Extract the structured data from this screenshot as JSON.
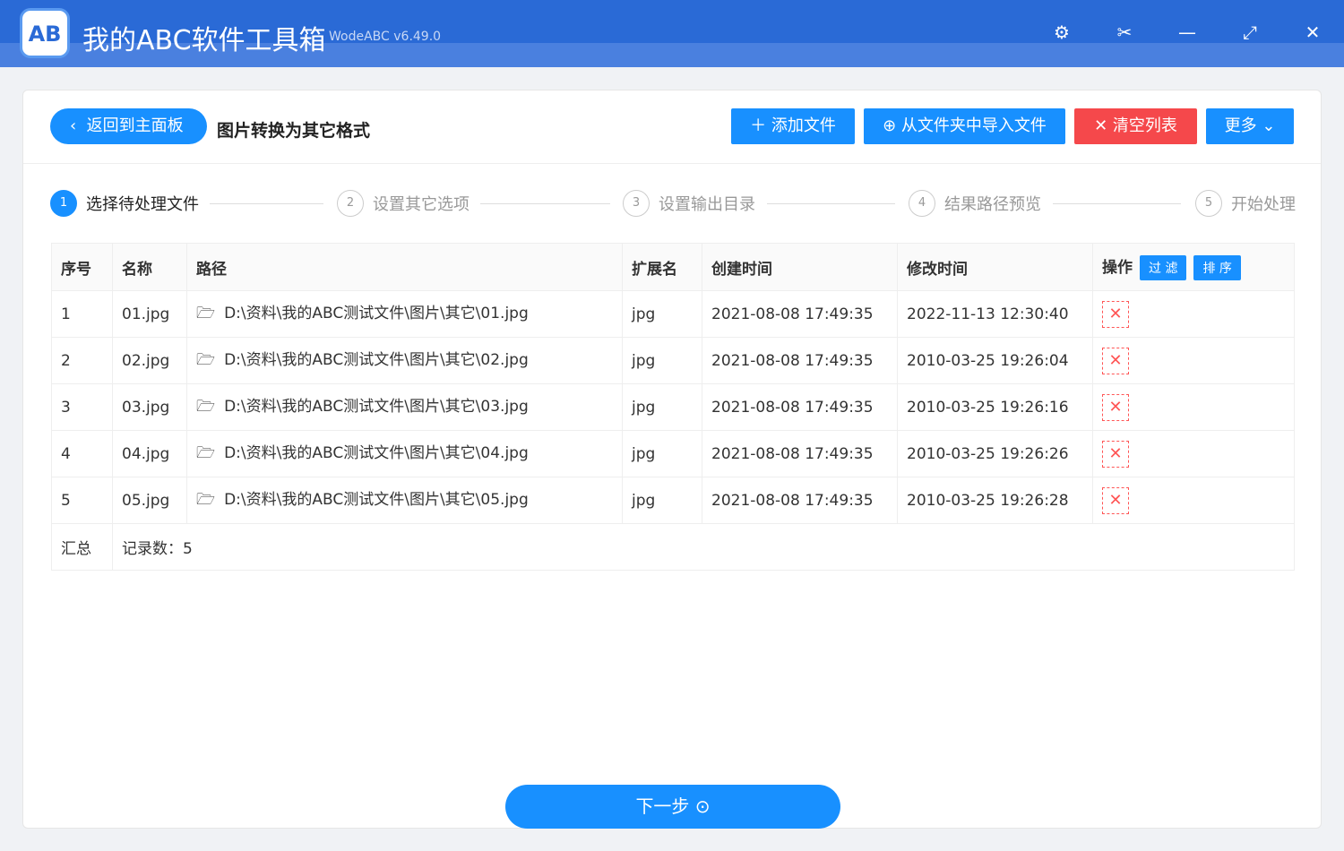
{
  "app": {
    "title": "我的ABC软件工具箱",
    "version": "WodeABC v6.49.0",
    "logo": "AB"
  },
  "window": {
    "settings": "⚙",
    "scissors": "✂",
    "minimize": "—",
    "maximize": "⤢",
    "close": "✕"
  },
  "header": {
    "back": "返回到主面板",
    "title": "图片转换为其它格式",
    "add": "添加文件",
    "import": "从文件夹中导入文件",
    "clear": "清空列表",
    "more": "更多"
  },
  "steps": [
    {
      "n": "1",
      "label": "选择待处理文件"
    },
    {
      "n": "2",
      "label": "设置其它选项"
    },
    {
      "n": "3",
      "label": "设置输出目录"
    },
    {
      "n": "4",
      "label": "结果路径预览"
    },
    {
      "n": "5",
      "label": "开始处理"
    }
  ],
  "table": {
    "headers": [
      "序号",
      "名称",
      "路径",
      "扩展名",
      "创建时间",
      "修改时间",
      "操作"
    ],
    "filter": "过 滤",
    "sort": "排 序",
    "rows": [
      [
        "1",
        "01.jpg",
        "D:\\资料\\我的ABC测试文件\\图片\\其它\\01.jpg",
        "jpg",
        "2021-08-08 17:49:35",
        "2022-11-13 12:30:40"
      ],
      [
        "2",
        "02.jpg",
        "D:\\资料\\我的ABC测试文件\\图片\\其它\\02.jpg",
        "jpg",
        "2021-08-08 17:49:35",
        "2010-03-25 19:26:04"
      ],
      [
        "3",
        "03.jpg",
        "D:\\资料\\我的ABC测试文件\\图片\\其它\\03.jpg",
        "jpg",
        "2021-08-08 17:49:35",
        "2010-03-25 19:26:16"
      ],
      [
        "4",
        "04.jpg",
        "D:\\资料\\我的ABC测试文件\\图片\\其它\\04.jpg",
        "jpg",
        "2021-08-08 17:49:35",
        "2010-03-25 19:26:26"
      ],
      [
        "5",
        "05.jpg",
        "D:\\资料\\我的ABC测试文件\\图片\\其它\\05.jpg",
        "jpg",
        "2021-08-08 17:49:35",
        "2010-03-25 19:26:28"
      ]
    ],
    "summary_label": "汇总",
    "summary_value": "记录数：5"
  },
  "next": "下一步 ⊙"
}
